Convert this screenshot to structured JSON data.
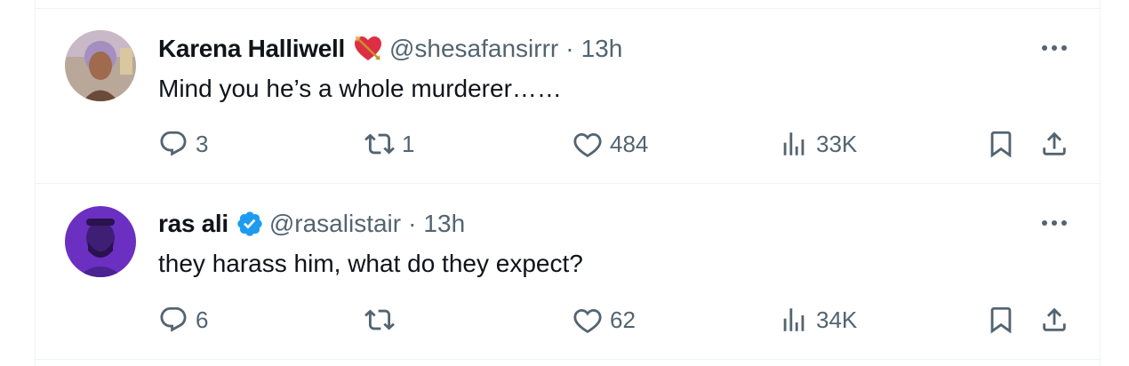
{
  "tweets": [
    {
      "display_name": "Karena Halliwell",
      "handle": "@shesafansirrr",
      "separator": "·",
      "time": "13h",
      "badge": "heart-with-arrow-emoji",
      "text": "Mind you he’s a whole murderer……",
      "replies": "3",
      "reposts": "1",
      "likes": "484",
      "views": "33K"
    },
    {
      "display_name": "ras ali",
      "handle": "@rasalistair",
      "separator": "·",
      "time": "13h",
      "badge": "verified-badge",
      "text": "they harass him, what do they expect?",
      "replies": "6",
      "reposts": "",
      "likes": "62",
      "views": "34K"
    }
  ],
  "colors": {
    "text": "#0f1419",
    "secondary": "#536471",
    "border": "#eff3f4",
    "verified": "#1d9bf0",
    "avatar2_bg": "#6b2fc1"
  }
}
